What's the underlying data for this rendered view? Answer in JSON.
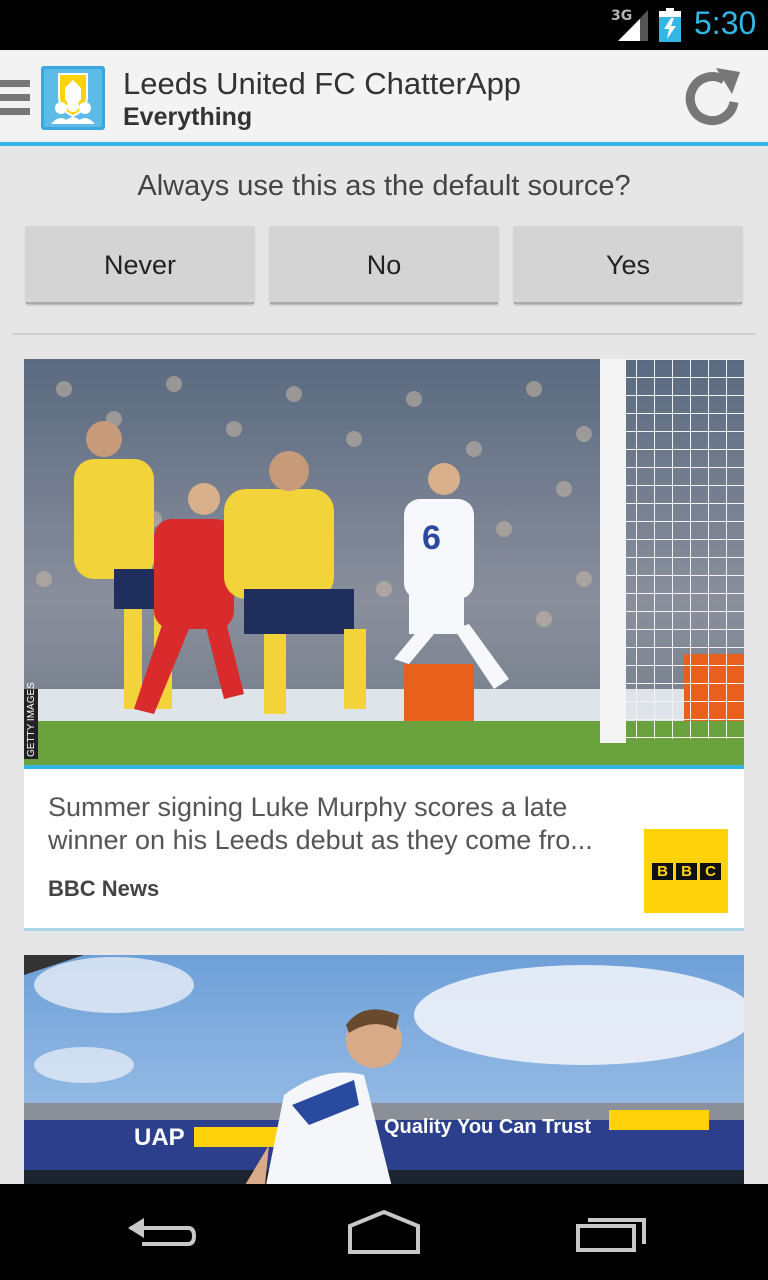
{
  "status_bar": {
    "network": "3G",
    "time": "5:30",
    "icons": [
      "signal-icon",
      "battery-charging-icon"
    ]
  },
  "action_bar": {
    "title": "Leeds United FC ChatterApp",
    "subtitle": "Everything",
    "icons": [
      "drawer-menu-icon",
      "app-logo-icon",
      "refresh-icon"
    ]
  },
  "default_source_prompt": {
    "question": "Always use this as the default source?",
    "buttons": [
      "Never",
      "No",
      "Yes"
    ]
  },
  "feed": [
    {
      "headline_line1": "Summer signing Luke Murphy scores a late",
      "headline_line2": "winner on his Leeds debut as they come fro...",
      "source": "BBC News",
      "source_logo_letters": [
        "B",
        "B",
        "C"
      ],
      "image_credit": "GETTY IMAGES"
    },
    {
      "image_banner": "Quality You Can Trust"
    }
  ],
  "nav_bar": {
    "icons": [
      "back-icon",
      "home-icon",
      "recent-apps-icon"
    ]
  },
  "colors": {
    "accent": "#33b5e5",
    "bbc_yellow": "#ffd20a"
  }
}
